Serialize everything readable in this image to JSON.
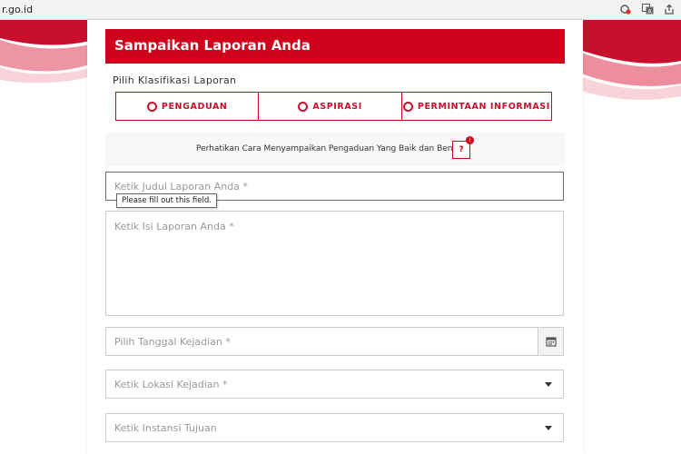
{
  "browser": {
    "url_fragment": "r.go.id",
    "icons": [
      "site-settings-icon",
      "translate-icon",
      "share-icon"
    ]
  },
  "form": {
    "title": "Sampaikan Laporan Anda",
    "classification_label": "Pilih Klasifikasi Laporan",
    "classification_options": [
      "PENGADUAN",
      "ASPIRASI",
      "PERMINTAAN INFORMASI"
    ],
    "hint_text": "Perhatikan Cara Menyampaikan Pengaduan Yang Baik dan Benar",
    "help_label": "?",
    "help_badge": "!",
    "judul_placeholder": "Ketik Judul Laporan Anda *",
    "validation_tooltip": "Please fill out this field.",
    "isi_placeholder": "Ketik Isi Laporan Anda *",
    "tanggal_placeholder": "Pilih Tanggal Kejadian *",
    "lokasi_placeholder": "Ketik Lokasi Kejadian *",
    "instansi_placeholder": "Ketik Instansi Tujuan"
  },
  "colors": {
    "brand_red": "#d0021b",
    "accent_red": "#c8102e"
  }
}
